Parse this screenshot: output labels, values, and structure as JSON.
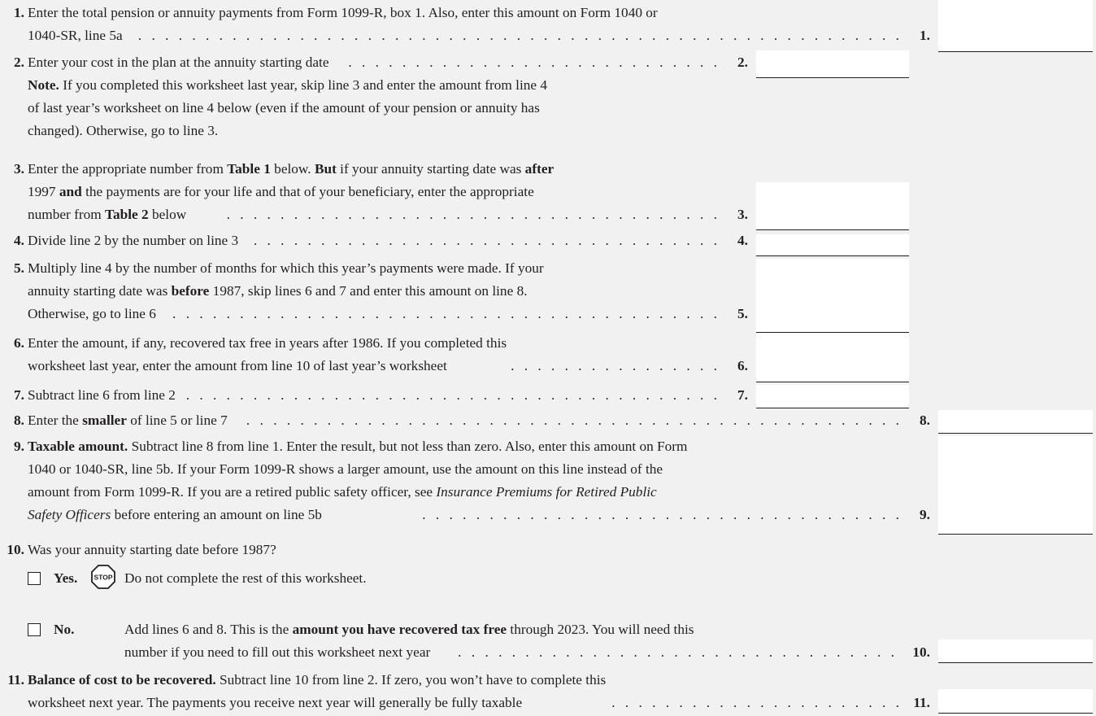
{
  "lines": {
    "l1": {
      "num": "1.",
      "row1": "Enter the total pension or annuity payments from Form 1099-R, box 1. Also, enter this amount on Form 1040 or",
      "row2": "1040-SR, line 5a",
      "ref": "1."
    },
    "l2": {
      "num": "2.",
      "row1": "Enter your cost in the plan at the annuity starting date",
      "ref": "2.",
      "note_label": "Note.",
      "note_row1": "If you completed this worksheet last year, skip line 3 and enter the amount from line 4",
      "note_row2": "of last year’s worksheet on line 4 below (even if the amount of your pension or annuity has",
      "note_row3": "changed). Otherwise, go to line 3."
    },
    "l3": {
      "num": "3.",
      "row1_a": "Enter the appropriate number from",
      "row1_b": "Table 1",
      "row1_c": "below.",
      "row1_d": "But",
      "row1_e": "if your annuity starting date was",
      "row1_f": "after",
      "row2_a": "1997",
      "row2_b": "and",
      "row2_c": "the payments are for your life and that of your beneficiary, enter the appropriate",
      "row3_a": "number from",
      "row3_b": "Table 2",
      "row3_c": "below",
      "ref": "3."
    },
    "l4": {
      "num": "4.",
      "row1": "Divide line 2 by the number on line 3",
      "ref": "4."
    },
    "l5": {
      "num": "5.",
      "row1": "Multiply line 4 by the number of months for which this year’s payments were made. If your",
      "row2_a": "annuity starting date was",
      "row2_b": "before",
      "row2_c": "1987, skip lines 6 and 7 and enter this amount on line 8.",
      "row3": "Otherwise, go to line 6",
      "ref": "5."
    },
    "l6": {
      "num": "6.",
      "row1": "Enter the amount, if any, recovered tax free in years after 1986. If you completed this",
      "row2": "worksheet last year, enter the amount from line 10 of last year’s worksheet",
      "ref": "6."
    },
    "l7": {
      "num": "7.",
      "row1": "Subtract line 6 from line 2",
      "ref": "7."
    },
    "l8": {
      "num": "8.",
      "row1_a": "Enter the",
      "row1_b": "smaller",
      "row1_c": "of line 5 or line 7",
      "ref": "8."
    },
    "l9": {
      "num": "9.",
      "row1_a": "Taxable amount.",
      "row1_b": "Subtract line 8 from line 1. Enter the result, but not less than zero. Also, enter this amount on Form",
      "row2": "1040 or 1040-SR, line 5b. If your Form 1099-R shows a larger amount, use the amount on this line instead of the",
      "row3": "amount from Form 1099-R. If you are a retired public safety officer, see",
      "row3_i": "Insurance Premiums for Retired Public",
      "row4_i": "Safety Officers",
      "row4": "before entering an amount on line 5b",
      "ref": "9."
    },
    "l10": {
      "num": "10.",
      "question": "Was your annuity starting date before 1987?",
      "yes_label": "Yes.",
      "stop_text": "STOP",
      "yes_text": "Do not complete the rest of this worksheet.",
      "no_label": "No.",
      "no_row1_a": "Add lines 6 and 8. This is the",
      "no_row1_b": "amount you have recovered tax free",
      "no_row1_c": "through 2023. You will need this",
      "no_row2": "number if you need to fill out this worksheet next year",
      "ref": "10."
    },
    "l11": {
      "num": "11.",
      "row1_a": "Balance of cost to be recovered.",
      "row1_b": "Subtract line 10 from line 2. If zero, you won’t have to complete this",
      "row2": "worksheet next year. The payments you receive next year will generally be fully taxable",
      "ref": "11."
    }
  },
  "fields": {
    "line1": "",
    "line2": "",
    "line3": "",
    "line4": "",
    "line5": "",
    "line6": "",
    "line7": "",
    "line8": "",
    "line9": "",
    "line10": "",
    "line11": ""
  },
  "checkboxes": {
    "yes_checked": false,
    "no_checked": false
  }
}
